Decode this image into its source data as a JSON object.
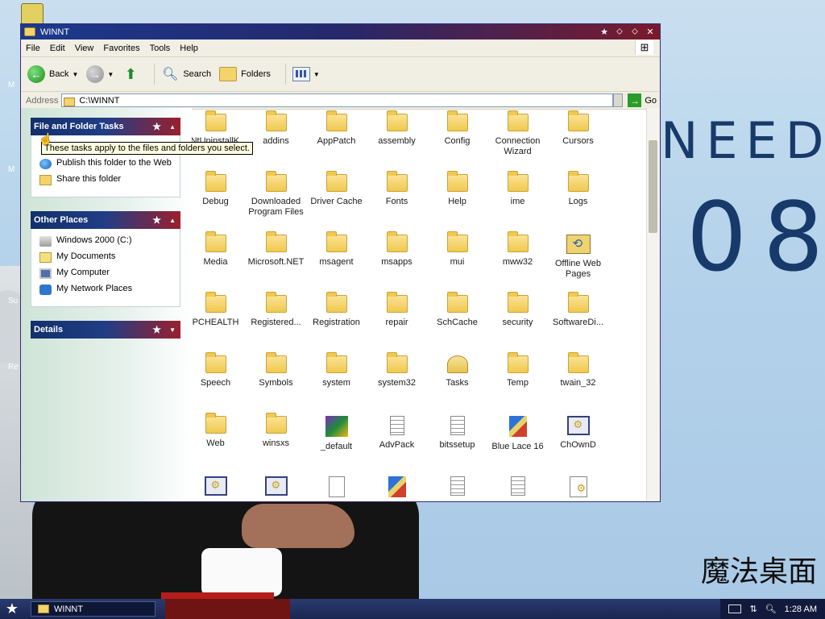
{
  "desktop": {
    "wallpaper_text_need": "NEED",
    "wallpaper_text_year": "08",
    "brand": "魔法桌面",
    "left_labels": [
      "M",
      "M",
      "Su",
      "Re"
    ]
  },
  "window": {
    "title": "WINNT",
    "controls": [
      "★",
      "⬦",
      "⬦",
      "✕"
    ],
    "menu": [
      "File",
      "Edit",
      "View",
      "Favorites",
      "Tools",
      "Help"
    ],
    "toolbar": {
      "back": "Back",
      "search": "Search",
      "folders": "Folders"
    },
    "address": {
      "label": "Address",
      "value": "C:\\WINNT",
      "go": "Go"
    }
  },
  "tasks_panel": {
    "title": "File and Folder Tasks",
    "tooltip": "These tasks apply to the files and folders you select.",
    "items": [
      "Publish this folder to the Web",
      "Share this folder"
    ]
  },
  "other_places": {
    "title": "Other Places",
    "items": [
      "Windows 2000 (C:)",
      "My Documents",
      "My Computer",
      "My Network Places"
    ]
  },
  "details": {
    "title": "Details"
  },
  "files": [
    {
      "label": "$NtUninstallK... .5SP1$",
      "icon": "folder"
    },
    {
      "label": "addins",
      "icon": "folder"
    },
    {
      "label": "AppPatch",
      "icon": "folder"
    },
    {
      "label": "assembly",
      "icon": "folder"
    },
    {
      "label": "Config",
      "icon": "folder"
    },
    {
      "label": "Connection Wizard",
      "icon": "folder"
    },
    {
      "label": "Cursors",
      "icon": "folder"
    },
    {
      "label": "Debug",
      "icon": "folder"
    },
    {
      "label": "Downloaded Program Files",
      "icon": "folder"
    },
    {
      "label": "Driver Cache",
      "icon": "folder"
    },
    {
      "label": "Fonts",
      "icon": "folder"
    },
    {
      "label": "Help",
      "icon": "folder"
    },
    {
      "label": "ime",
      "icon": "folder"
    },
    {
      "label": "Logs",
      "icon": "folder"
    },
    {
      "label": "Media",
      "icon": "folder"
    },
    {
      "label": "Microsoft.NET",
      "icon": "folder"
    },
    {
      "label": "msagent",
      "icon": "folder"
    },
    {
      "label": "msapps",
      "icon": "folder"
    },
    {
      "label": "mui",
      "icon": "folder"
    },
    {
      "label": "mww32",
      "icon": "folder"
    },
    {
      "label": "Offline Web Pages",
      "icon": "offline"
    },
    {
      "label": "PCHEALTH",
      "icon": "folder"
    },
    {
      "label": "Registered...",
      "icon": "folder"
    },
    {
      "label": "Registration",
      "icon": "folder"
    },
    {
      "label": "repair",
      "icon": "folder"
    },
    {
      "label": "SchCache",
      "icon": "folder"
    },
    {
      "label": "security",
      "icon": "folder"
    },
    {
      "label": "SoftwareDi...",
      "icon": "folder"
    },
    {
      "label": "Speech",
      "icon": "folder"
    },
    {
      "label": "Symbols",
      "icon": "folder"
    },
    {
      "label": "system",
      "icon": "folder"
    },
    {
      "label": "system32",
      "icon": "folder"
    },
    {
      "label": "Tasks",
      "icon": "tasks"
    },
    {
      "label": "Temp",
      "icon": "folder"
    },
    {
      "label": "twain_32",
      "icon": "folder"
    },
    {
      "label": "Web",
      "icon": "folder"
    },
    {
      "label": "winsxs",
      "icon": "folder"
    },
    {
      "label": "_default",
      "icon": "ms"
    },
    {
      "label": "AdvPack",
      "icon": "file"
    },
    {
      "label": "bitssetup",
      "icon": "file"
    },
    {
      "label": "Blue Lace 16",
      "icon": "brush"
    },
    {
      "label": "ChOwnD",
      "icon": "exe"
    },
    {
      "label": "",
      "icon": "exe"
    },
    {
      "label": "",
      "icon": "exe"
    },
    {
      "label": "",
      "icon": "avi"
    },
    {
      "label": "",
      "icon": "brush"
    },
    {
      "label": "",
      "icon": "file"
    },
    {
      "label": "",
      "icon": "file"
    },
    {
      "label": "",
      "icon": "setup"
    }
  ],
  "taskbar": {
    "task_label": "WINNT",
    "clock": "1:28 AM"
  }
}
